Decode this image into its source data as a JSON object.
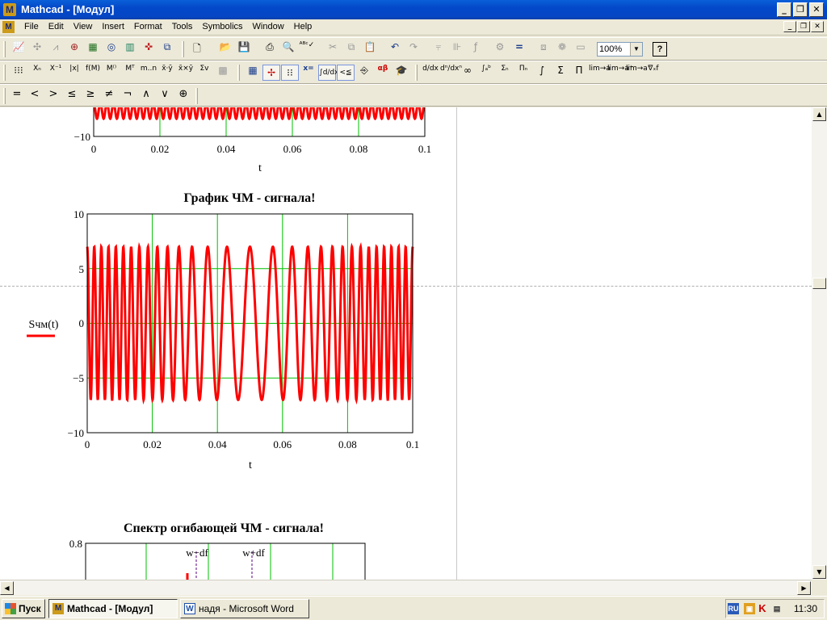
{
  "window": {
    "title": "Mathcad - [Модул]",
    "app_icon": "M"
  },
  "menu": [
    "File",
    "Edit",
    "View",
    "Insert",
    "Format",
    "Tools",
    "Symbolics",
    "Window",
    "Help"
  ],
  "toolbar": {
    "zoom": "100%",
    "help": "?"
  },
  "operators": [
    "=",
    "<",
    ">",
    "≤",
    "≥",
    "≠",
    "¬",
    "∧",
    "∨",
    "⊕"
  ],
  "plots": {
    "top": {
      "yticks": [
        "−10"
      ],
      "xticks": [
        "0",
        "0.02",
        "0.04",
        "0.06",
        "0.08",
        "0.1"
      ],
      "xlabel": "t"
    },
    "fm": {
      "title": "График ЧМ - сигнала!",
      "yticks": [
        "10",
        "5",
        "0",
        "−5",
        "−10"
      ],
      "xticks": [
        "0",
        "0.02",
        "0.04",
        "0.06",
        "0.08",
        "0.1"
      ],
      "xlabel": "t",
      "ylabel": "Sчм(t)"
    },
    "spectrum": {
      "title": "Спектр огибающей ЧМ - сигнала!",
      "yticks": [
        "0.8"
      ],
      "marker1": "w−df",
      "marker2": "w+df"
    }
  },
  "chart_data": [
    {
      "type": "line",
      "x_range": [
        0,
        0.1
      ],
      "y_range_visible_min": -10,
      "xlabel": "t",
      "series": [
        {
          "color": "#ff0000",
          "amplitude": 7
        }
      ]
    },
    {
      "type": "line",
      "title": "График ЧМ - сигнала!",
      "xlabel": "t",
      "ylabel": "Sчм(t)",
      "xlim": [
        0,
        0.1
      ],
      "ylim": [
        -10,
        10
      ],
      "grid": true,
      "grid_color": "#00c000",
      "series": [
        {
          "color": "#ff0000",
          "amplitude": 7,
          "cycles": 30
        }
      ]
    },
    {
      "type": "bar",
      "title": "Спектр огибающей ЧМ - сигнала!",
      "ylim_top": 0.8,
      "markers": [
        "w−df",
        "w+df"
      ]
    }
  ],
  "taskbar": {
    "start": "Пуск",
    "tasks": [
      "Mathcad - [Модул]",
      "надя - Microsoft Word"
    ],
    "lang": "RU",
    "clock": "11:30"
  }
}
